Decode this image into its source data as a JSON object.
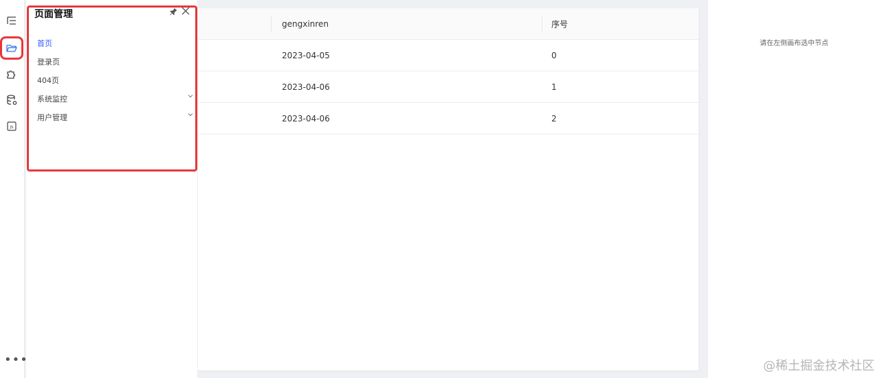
{
  "rail": {
    "icons": [
      "outline-tree-icon",
      "folder-open-icon",
      "puzzle-plugin-icon",
      "database-settings-icon",
      "js-file-icon"
    ],
    "more_label": "•••",
    "active_color": "#e5383b"
  },
  "page_manager": {
    "title": "页面管理",
    "items": [
      {
        "label": "首页",
        "active": true
      },
      {
        "label": "登录页",
        "active": false
      },
      {
        "label": "404页",
        "active": false
      },
      {
        "label": "系统监控",
        "expandable": true
      },
      {
        "label": "用户管理",
        "expandable": true
      }
    ],
    "active_color": "#2f5cff"
  },
  "table": {
    "columns": [
      "gengxinren",
      "序号"
    ],
    "rows": [
      [
        "2023-04-05",
        "0"
      ],
      [
        "2023-04-06",
        "1"
      ],
      [
        "2023-04-06",
        "2"
      ]
    ]
  },
  "right_panel": {
    "hint": "请在左侧画布选中节点"
  },
  "watermark": "@稀土掘金技术社区"
}
